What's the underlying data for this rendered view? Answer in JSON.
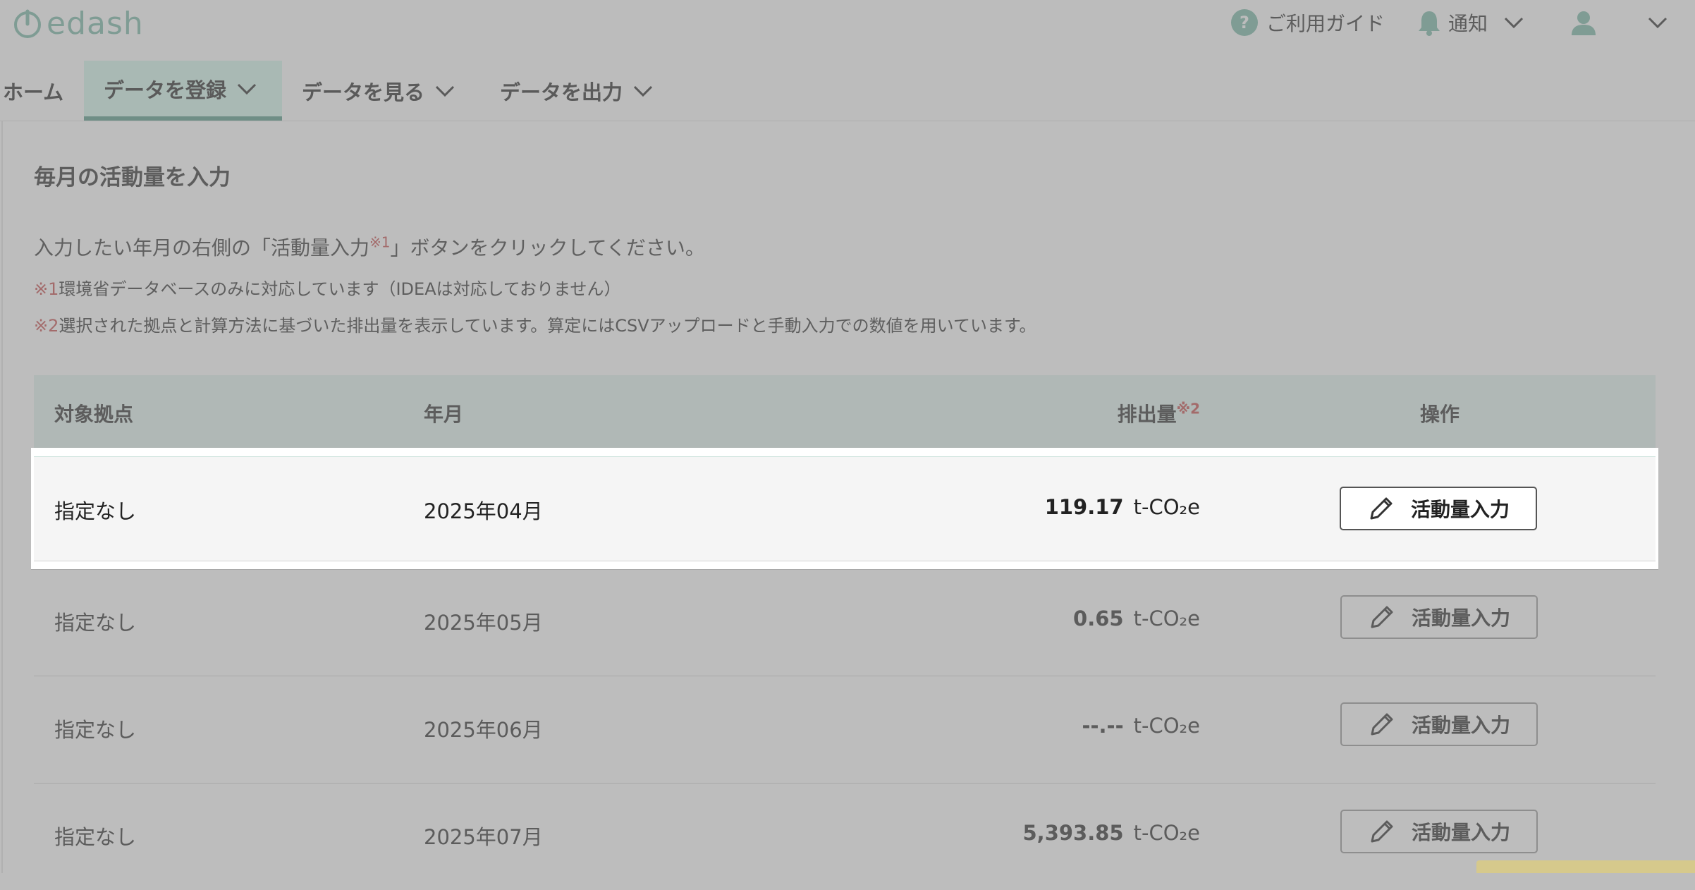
{
  "header": {
    "logo": "edash",
    "guide_label": "ご利用ガイド",
    "notice_label": "通知",
    "icons": [
      "power-logo-icon",
      "question-icon",
      "bell-icon",
      "user-icon",
      "chevron-down-icon"
    ]
  },
  "nav": {
    "items": [
      {
        "label": "ホーム"
      },
      {
        "label": "データを登録"
      },
      {
        "label": "データを見る"
      },
      {
        "label": "データを出力"
      }
    ]
  },
  "page": {
    "title": "毎月の活動量を入力",
    "desc_before": "入力したい年月の右側の「活動量入力",
    "desc_mark": "※1",
    "desc_after": "」ボタンをクリックしてください。",
    "note1_mark": "※1",
    "note1_text": "環境省データベースのみに対応しています（IDEAは対応しておりません）",
    "note2_mark": "※2",
    "note2_text": "選択された拠点と計算方法に基づいた排出量を表示しています。算定にはCSVアップロードと手動入力での数値を用いています。"
  },
  "table": {
    "headers": {
      "site": "対象拠点",
      "month": "年月",
      "emission": "排出量",
      "emission_mark": "※2",
      "action": "操作"
    },
    "unit": "t-CO₂e",
    "button_label": "活動量入力",
    "rows": [
      {
        "site": "指定なし",
        "month": "2025年04月",
        "value": "119.17"
      },
      {
        "site": "指定なし",
        "month": "2025年05月",
        "value": "0.65"
      },
      {
        "site": "指定なし",
        "month": "2025年06月",
        "value": "--.--"
      },
      {
        "site": "指定なし",
        "month": "2025年07月",
        "value": "5,393.85"
      }
    ]
  },
  "colors": {
    "overlay": "#bdbdbd",
    "brand": "#7f9c94",
    "highlight_row": "#f5f5f5",
    "note_mark": "#a36b6b"
  }
}
